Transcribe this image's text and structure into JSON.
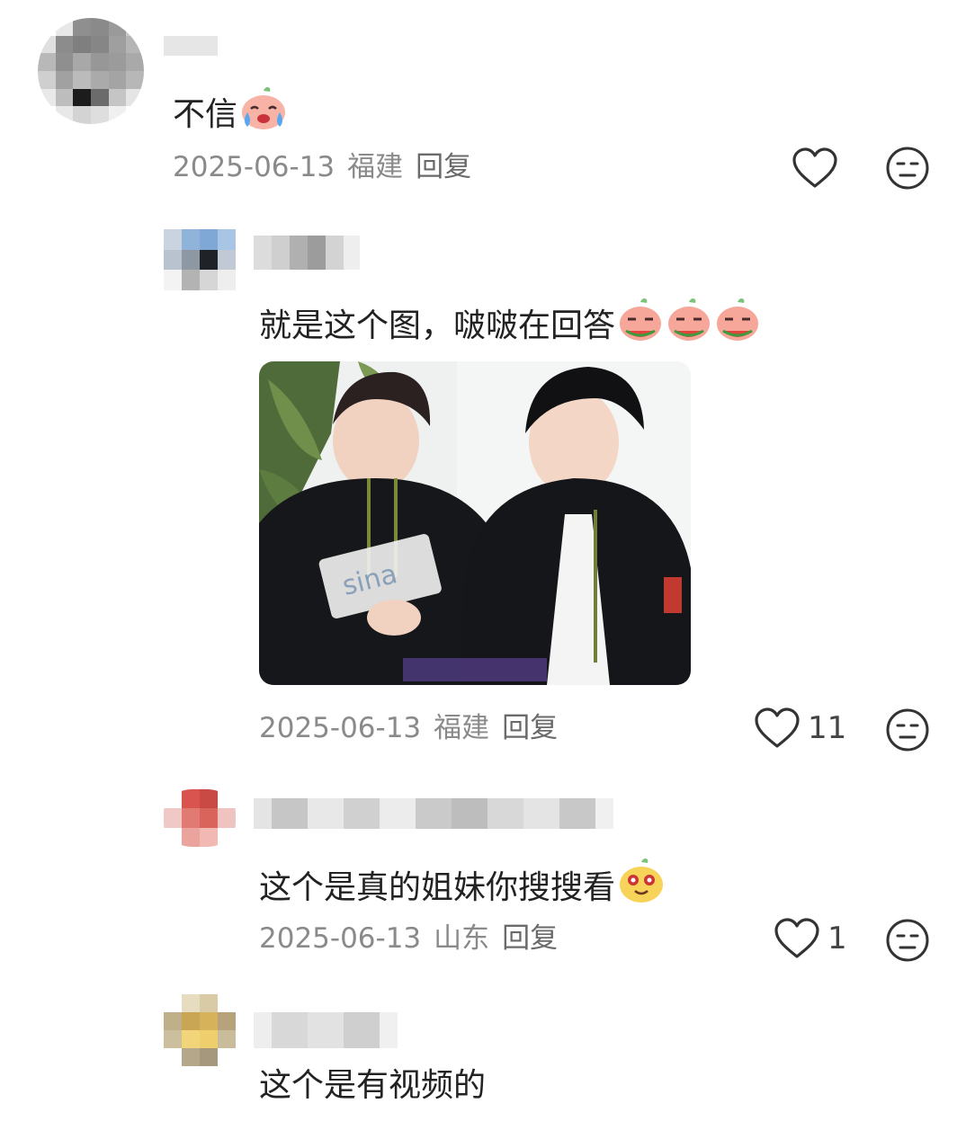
{
  "comments": [
    {
      "text": "不信",
      "date": "2025-06-13",
      "location": "福建",
      "reply_label": "回复",
      "likes": ""
    },
    {
      "text": "就是这个图，啵啵在回答",
      "date": "2025-06-13",
      "location": "福建",
      "reply_label": "回复",
      "likes": "11"
    },
    {
      "text": "这个是真的姐妹你搜搜看",
      "date": "2025-06-13",
      "location": "山东",
      "reply_label": "回复",
      "likes": "1"
    },
    {
      "text": "这个是有视频的"
    }
  ],
  "colors": {
    "meta_text": "#8a8a8a",
    "icon_stroke": "#333333",
    "emoji_peach": "#f6a79a",
    "emoji_yellow": "#f7d35a"
  },
  "icons": [
    "heart-icon",
    "neutral-face-icon",
    "crying-peach-emoji",
    "watermelon-peach-emoji",
    "yellow-face-emoji"
  ]
}
